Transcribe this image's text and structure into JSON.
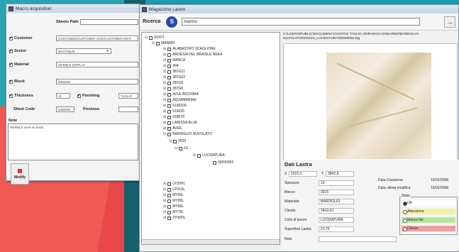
{
  "acq": {
    "title": "Macro acquisition",
    "sheet_path_label": "Sheets Path",
    "customer_label": "Customer",
    "customer_value": "CUSTOMER/CUSTOMER SITE/CUSTOMER INFO",
    "sector_label": "Sector",
    "sector_value": "BOUTIQUE",
    "material_label": "Material",
    "material_value": "MARBLE DISPLAY",
    "block_label": "Block",
    "block_value": "0000000",
    "thickness_label": "Thickness",
    "thickness_value": "21",
    "finishing_label": "Finishing",
    "finishing_value": "TAGLIO",
    "sheet_code_label": "Sheet Code",
    "sheet_code_value": "0000000",
    "previous_label": "Previous",
    "previous_value": "",
    "note_label": "Note",
    "note_value": "MARBLE vene su bordi",
    "modify_label": "Modify"
  },
  "mag": {
    "title": "Magazzino Lastre",
    "search_label": "Ricerca",
    "search_value": "marmo",
    "go_label": "→",
    "path": "C:\\USERS\\PUBLIC\\DOCUMENTS\\VINTAG TAGLIO 2\\DRAWVCAD\\MARMO\\BARDIGLIO NUVOLATO\\0015\\10_LUCIDATURA\\00000052.tag",
    "tree": [
      {
        "label": "ROOT",
        "pm": "⊟"
      },
      {
        "label": "MARMO",
        "pm": "⊟"
      },
      {
        "label": "ALABASTRO SCAGLIONE",
        "pm": "⊞"
      },
      {
        "label": "ARDESIA DEL BRASILE NERA",
        "pm": "⊞"
      },
      {
        "label": "MANCA",
        "pm": "⊞"
      },
      {
        "label": "304",
        "pm": "⊞"
      },
      {
        "label": "387G11",
        "pm": "⊞"
      },
      {
        "label": "387G22",
        "pm": "⊞"
      },
      {
        "label": "387G5",
        "pm": "⊞"
      },
      {
        "label": "387G9",
        "pm": "⊞"
      },
      {
        "label": "AZUL BOCHIRA",
        "pm": "⊞"
      },
      {
        "label": "AQUAMARINE",
        "pm": "⊞"
      },
      {
        "label": "5168200",
        "pm": "⊞"
      },
      {
        "label": "516025",
        "pm": "⊞"
      },
      {
        "label": "918578",
        "pm": "⊞"
      },
      {
        "label": "LARISSA BLUE",
        "pm": "⊞"
      },
      {
        "label": "AVEIL",
        "pm": "⊞"
      },
      {
        "label": "BARDIGLIO NUVOLATO",
        "pm": "⊟"
      },
      {
        "label": "0015",
        "pm": "⊟"
      },
      {
        "label": "10",
        "pm": "⊟"
      },
      {
        "label": "LUCIDATURA",
        "pm": "⊟"
      },
      {
        "label": "00000052",
        "pm": ""
      },
      {
        "label": "LP30HL",
        "pm": "⊞"
      },
      {
        "label": "LP31SL",
        "pm": "⊞"
      },
      {
        "label": "MY50L",
        "pm": "⊞"
      },
      {
        "label": "MY65L",
        "pm": "⊞"
      },
      {
        "label": "MY66L",
        "pm": "⊞"
      },
      {
        "label": "MY70L",
        "pm": "⊞"
      },
      {
        "label": "TP30HL",
        "pm": "⊞"
      }
    ],
    "dati": {
      "title": "Dati Lastra",
      "x_label": "X",
      "x_value": "1515,3",
      "y_label": "Y",
      "y_value": "3842,8",
      "spessore_label": "Spessore",
      "spessore_value": "10",
      "blocco_label": "Blocco",
      "blocco_value": "0015",
      "materiale_label": "Materiale",
      "materiale_value": "BARDIGLIO",
      "cliente_label": "Cliente",
      "cliente_value": "TAGLIO",
      "ciclo_label": "Ciclo di lavoro",
      "ciclo_value": "LUCIDATURA",
      "superficie_label": "Superficie Lastra",
      "superficie_value": "21,75",
      "note_label": "Note",
      "note_value": "",
      "data_creazione_label": "Data Creazione",
      "data_creazione_value": "15/02/2008",
      "data_modifica_label": "Data ultima modifica",
      "data_modifica_value": "15/02/2008",
      "stato_label": "Stato",
      "stato_options": [
        "OK",
        "Attenzione",
        "Manca file",
        "Chiuso"
      ],
      "stato_colors": [
        "#ffffff",
        "#f5f0a0",
        "#b8e6a0",
        "#f0a0a0"
      ]
    }
  }
}
